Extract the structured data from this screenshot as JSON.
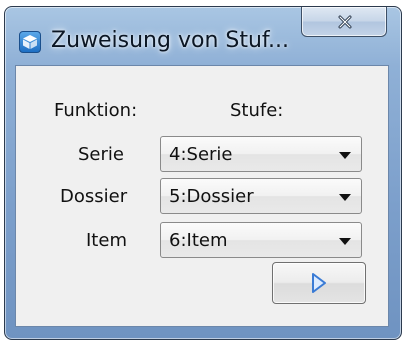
{
  "window": {
    "title": "Zuweisung von Stuf...",
    "icon": "cube-app-icon",
    "close_icon": "close-x-icon"
  },
  "form": {
    "column_headers": {
      "function": "Funktion:",
      "level": "Stufe:"
    },
    "rows": [
      {
        "function_label": "Serie",
        "selected_level": "4:Serie"
      },
      {
        "function_label": "Dossier",
        "selected_level": "5:Dossier"
      },
      {
        "function_label": "Item",
        "selected_level": "6:Item"
      }
    ],
    "dropdown_icon": "chevron-down-icon",
    "next_button_icon": "play-triangle-icon"
  },
  "colors": {
    "titlebar": "#8fb0d6",
    "client_background": "#f0f0f0",
    "next_icon": "#3a7bd5"
  }
}
